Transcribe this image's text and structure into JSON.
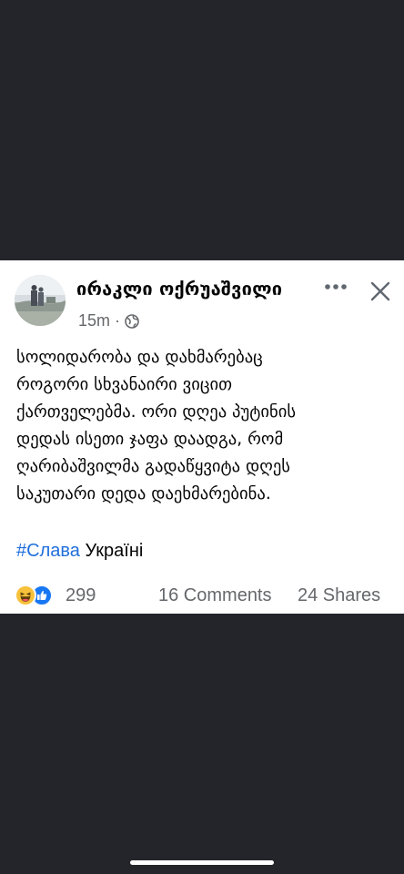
{
  "post": {
    "author": "ირაკლი ოქრუაშვილი",
    "time": "15m",
    "separator": "·",
    "audience_icon": "globe-icon",
    "text_lines": [
      "სოლიდარობა და დახმარებაც",
      "როგორი სხვანაირი ვიცით",
      "ქართველებმა. ორი დღეა პუტინის",
      "დედას ისეთი ჯაფა დაადგა, რომ",
      "ღარიბაშვილმა გადაწყვიტა დღეს",
      "საკუთარი დედა დაეხმარებინა."
    ],
    "hashtag": "#Слава",
    "hashtag_rest": "Україні",
    "reactions": {
      "icons": [
        "haha-icon",
        "like-icon"
      ],
      "count": "299"
    },
    "comments": "16 Comments",
    "shares": "24 Shares",
    "more_icon": "more-horizontal-icon",
    "close_icon": "close-icon"
  },
  "colors": {
    "background": "#24252a",
    "card": "#ffffff",
    "text": "#050505",
    "secondary": "#65676b",
    "hashtag": "#216fdb",
    "like_blue": "#1877f2",
    "haha_yellow": "#f7c13b"
  }
}
